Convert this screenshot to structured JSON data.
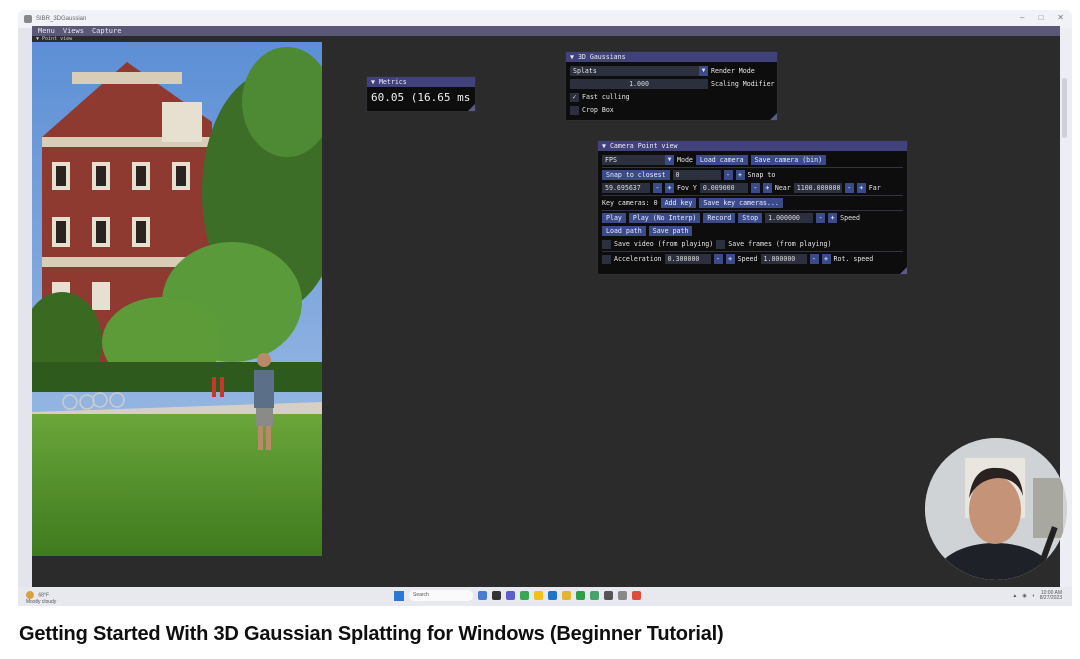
{
  "video": {
    "title": "Getting Started With 3D Gaussian Splatting for Windows (Beginner Tutorial)"
  },
  "window": {
    "title": "SIBR_3DGaussian"
  },
  "menubar": {
    "items": [
      "Menu",
      "Views",
      "Capture"
    ],
    "subtitle": "▼ Point view"
  },
  "metrics": {
    "title": "▼ Metrics",
    "value": "60.05 (16.65 ms"
  },
  "gaussians": {
    "title": "▼ 3D Gaussians",
    "render_mode_value": "Splats",
    "render_mode_label": "Render Mode",
    "scaling_value": "1.000",
    "scaling_label": "Scaling Modifier",
    "fast_culling_label": "Fast culling",
    "fast_culling_checked": true,
    "crop_box_label": "Crop Box"
  },
  "camera": {
    "title": "▼ Camera Point view",
    "mode_value": "FPS",
    "mode_label": "Mode",
    "load_camera": "Load camera",
    "save_camera": "Save camera (bin)",
    "snap_closest": "Snap to closest",
    "snap_value": "0",
    "snap_to": "Snap to",
    "fov_value": "59.695637",
    "fov_label": "Fov Y",
    "near_value": "0.009000",
    "near_label": "Near",
    "far_value": "1100.000000",
    "far_label": "Far",
    "key_cameras": "Key cameras: 0",
    "add_key": "Add key",
    "save_key_cameras": "Save key cameras...",
    "play": "Play",
    "play_no_interp": "Play (No Interp)",
    "record": "Record",
    "stop": "Stop",
    "play_speed_value": "1.000000",
    "speed_label": "Speed",
    "load_path": "Load path",
    "save_path": "Save path",
    "save_video": "Save video (from playing)",
    "save_frames": "Save frames (from playing)",
    "acceleration_label": "Acceleration",
    "acceleration_value": "0.300000",
    "speed2_value": "1.000000",
    "rot_speed_label": "Rot. speed",
    "minus": "-",
    "plus": "+"
  },
  "taskbar": {
    "weather_temp": "68°F",
    "weather_desc": "Mostly cloudy",
    "search": "Search",
    "time": "10:00 AM",
    "date": "8/27/2023"
  },
  "colors": {
    "title_bar": "#42427a",
    "button": "#3b4b8a",
    "menubar": "#5a5779",
    "window_bg": "#0d0d0d"
  }
}
